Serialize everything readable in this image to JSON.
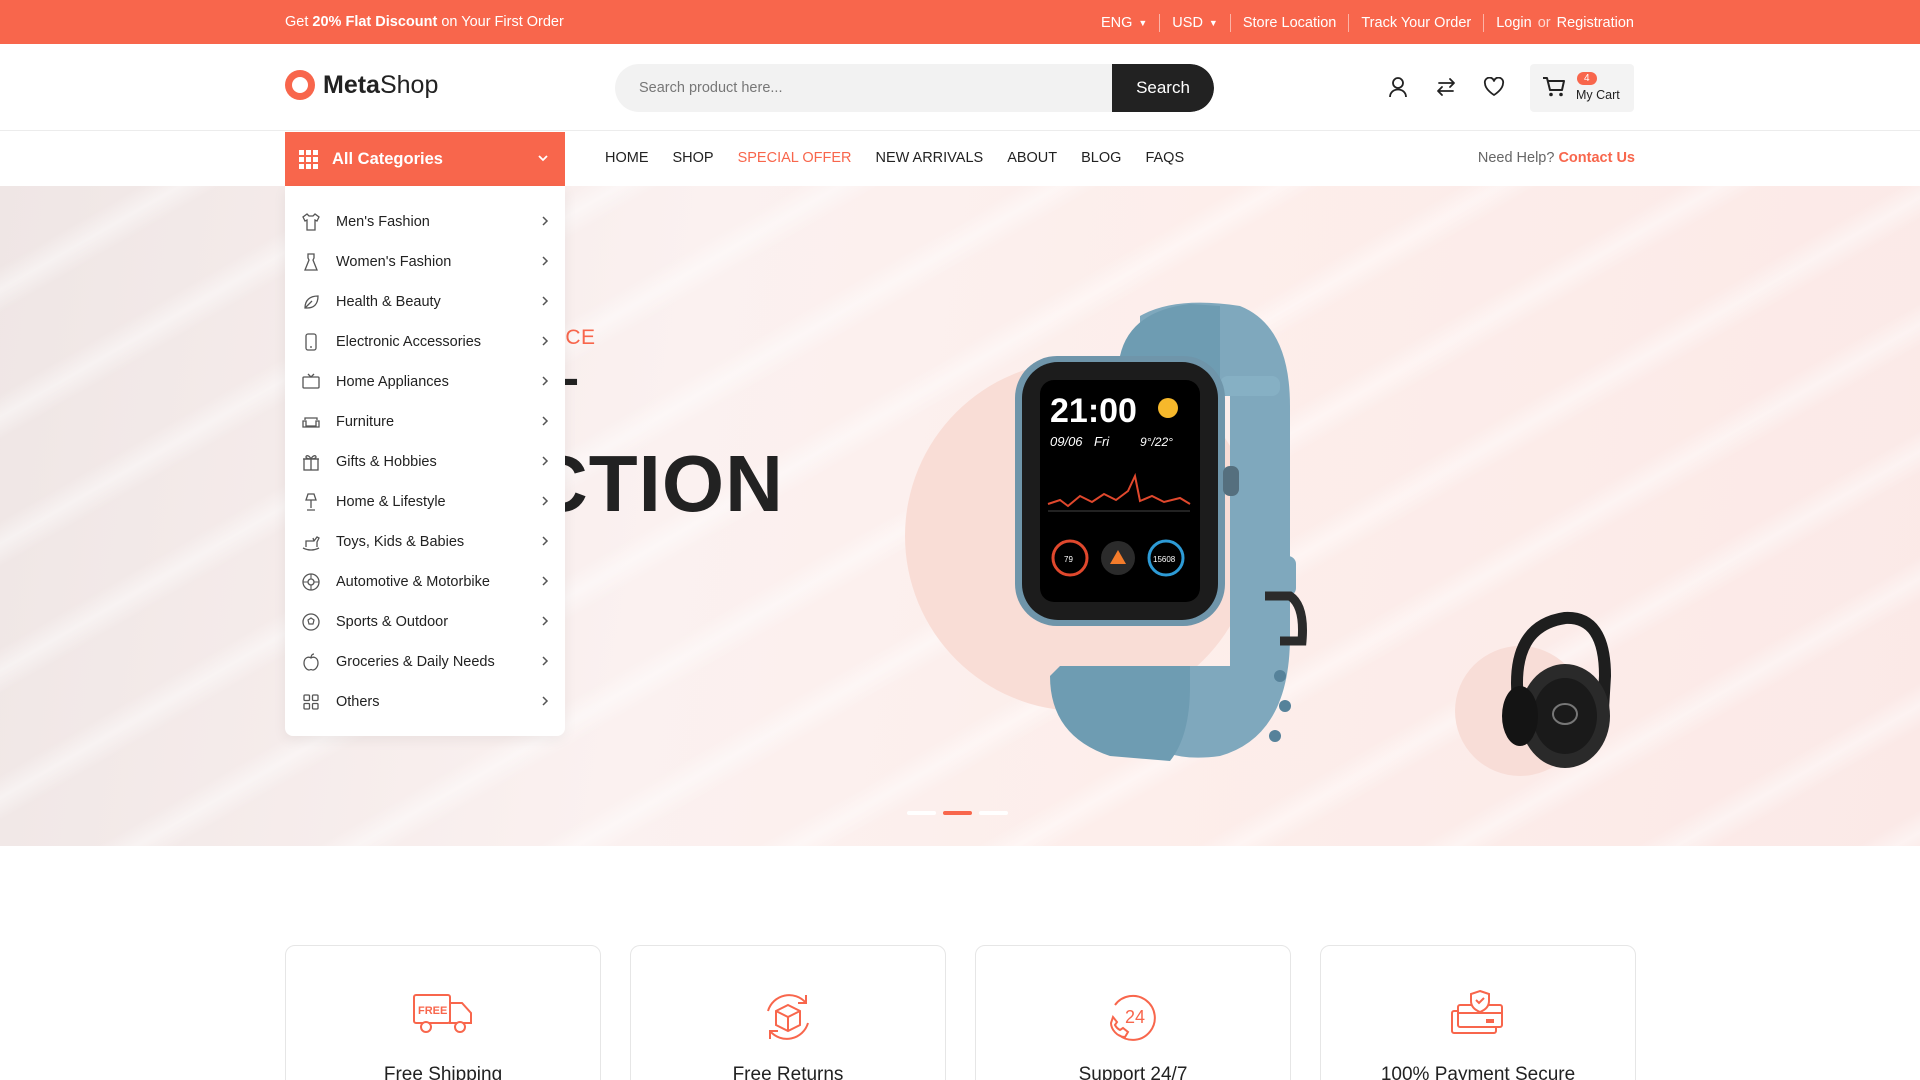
{
  "topbar": {
    "promo_prefix": "Get",
    "promo_bold": "20% Flat Discount",
    "promo_suffix": "on Your First Order",
    "language": "ENG",
    "currency": "USD",
    "store_location": "Store Location",
    "track_order": "Track Your Order",
    "login": "Login",
    "or": "or",
    "registration": "Registration"
  },
  "header": {
    "logo_bold": "Meta",
    "logo_rest": "Shop",
    "search_placeholder": "Search product here...",
    "search_button": "Search",
    "cart_count": "4",
    "cart_label": "My Cart"
  },
  "nav": {
    "all_categories": "All Categories",
    "menu": [
      "HOME",
      "SHOP",
      "SPECIAL OFFER",
      "NEW ARRIVALS",
      "ABOUT",
      "BLOG",
      "FAQS"
    ],
    "help_text": "Need Help?",
    "help_link": "Contact Us"
  },
  "categories": [
    {
      "label": "Men's Fashion",
      "icon": "shirt-icon"
    },
    {
      "label": "Women's Fashion",
      "icon": "dress-icon"
    },
    {
      "label": "Health & Beauty",
      "icon": "leaf-icon"
    },
    {
      "label": "Electronic Accessories",
      "icon": "device-icon"
    },
    {
      "label": "Home Appliances",
      "icon": "tv-icon"
    },
    {
      "label": "Furniture",
      "icon": "sofa-icon"
    },
    {
      "label": "Gifts & Hobbies",
      "icon": "gift-icon"
    },
    {
      "label": "Home & Lifestyle",
      "icon": "lamp-icon"
    },
    {
      "label": "Toys, Kids & Babies",
      "icon": "rocking-horse-icon"
    },
    {
      "label": "Automotive & Motorbike",
      "icon": "wheel-icon"
    },
    {
      "label": "Sports & Outdoor",
      "icon": "ball-icon"
    },
    {
      "label": "Groceries & Daily Needs",
      "icon": "apple-icon"
    },
    {
      "label": "Others",
      "icon": "grid-icon"
    }
  ],
  "hero": {
    "subtitle": "EVICE",
    "title_line1": "T",
    "title_line2": "CTION",
    "watch_time": "21:00",
    "watch_date": "09/06",
    "watch_day": "Fri",
    "watch_temp": "9°/22°",
    "watch_stat1": "79",
    "watch_stat2": "15608",
    "slides": 3,
    "active_slide": 2
  },
  "features": [
    {
      "title": "Free Shipping",
      "icon": "truck-icon",
      "badge": "FREE"
    },
    {
      "title": "Free Returns",
      "icon": "box-return-icon"
    },
    {
      "title": "Support 24/7",
      "icon": "support-24-icon",
      "badge": "24"
    },
    {
      "title": "100% Payment Secure",
      "icon": "secure-payment-icon"
    }
  ],
  "colors": {
    "accent": "#f8664c",
    "dark": "#222222"
  }
}
